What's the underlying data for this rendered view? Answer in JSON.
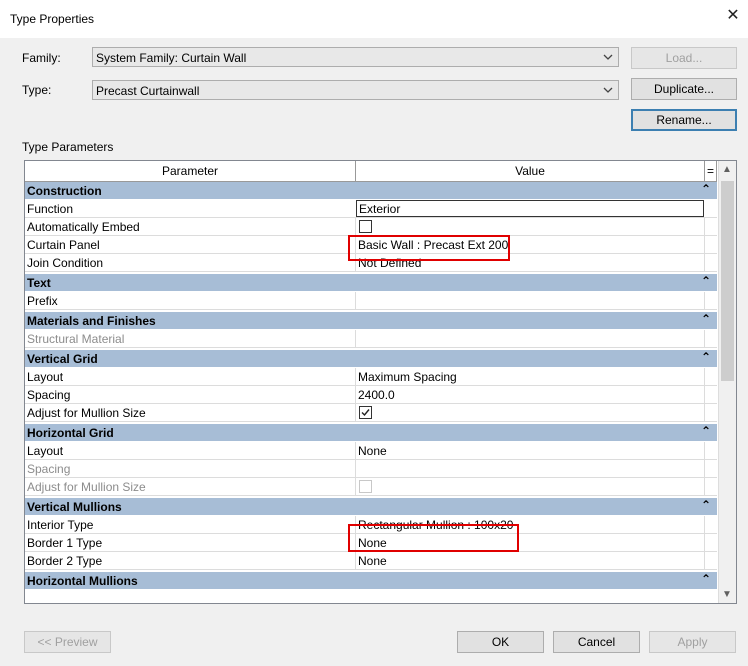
{
  "window": {
    "title": "Type Properties"
  },
  "family": {
    "label": "Family:",
    "value": "System Family: Curtain Wall"
  },
  "type": {
    "label": "Type:",
    "value": "Precast Curtainwall"
  },
  "buttons": {
    "load": "Load...",
    "duplicate": "Duplicate...",
    "rename": "Rename...",
    "preview": "<< Preview",
    "ok": "OK",
    "cancel": "Cancel",
    "apply": "Apply"
  },
  "section_label": "Type Parameters",
  "table": {
    "headers": {
      "parameter": "Parameter",
      "value": "Value",
      "eq": "="
    },
    "groups": {
      "construction": "Construction",
      "text": "Text",
      "materials": "Materials and Finishes",
      "vgrid": "Vertical Grid",
      "hgrid": "Horizontal Grid",
      "vmullions": "Vertical Mullions",
      "hmullions": "Horizontal Mullions"
    },
    "rows": {
      "function": {
        "param": "Function",
        "value": "Exterior"
      },
      "auto_embed": {
        "param": "Automatically Embed"
      },
      "curtain_panel": {
        "param": "Curtain Panel",
        "value": "Basic Wall : Precast Ext 200"
      },
      "join_condition": {
        "param": "Join Condition",
        "value": "Not Defined"
      },
      "prefix": {
        "param": "Prefix",
        "value": ""
      },
      "structural_material": {
        "param": "Structural Material",
        "value": ""
      },
      "vg_layout": {
        "param": "Layout",
        "value": "Maximum Spacing"
      },
      "vg_spacing": {
        "param": "Spacing",
        "value": "2400.0"
      },
      "vg_adjust": {
        "param": "Adjust for Mullion Size",
        "checked": true
      },
      "hg_layout": {
        "param": "Layout",
        "value": "None"
      },
      "hg_spacing": {
        "param": "Spacing",
        "value": ""
      },
      "hg_adjust": {
        "param": "Adjust for Mullion Size",
        "checked": false
      },
      "interior_type": {
        "param": "Interior Type",
        "value": "Rectangular Mullion : 100x20"
      },
      "border1": {
        "param": "Border 1 Type",
        "value": "None"
      },
      "border2": {
        "param": "Border 2 Type",
        "value": "None"
      }
    }
  },
  "colors": {
    "group_header": "#a7bdd6",
    "highlight": "#e00000",
    "focus": "#3c7fb1"
  },
  "icons": {
    "close": "close-icon",
    "dropdown": "chevron-down-icon",
    "collapse": "double-chevron-up-icon",
    "checkmark": "checkmark-icon"
  }
}
